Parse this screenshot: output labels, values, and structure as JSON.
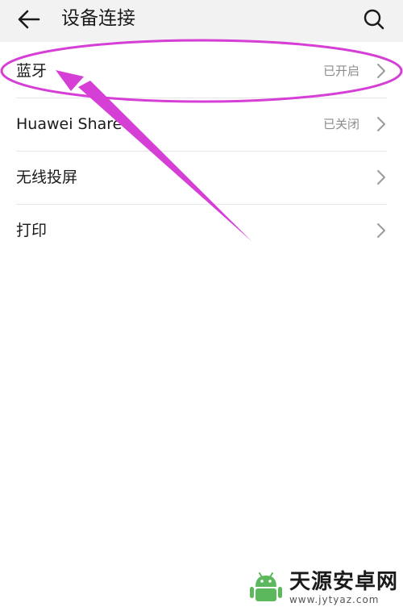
{
  "header": {
    "title": "设备连接",
    "back_icon": "arrow-left-icon",
    "search_icon": "search-icon"
  },
  "rows": [
    {
      "label": "蓝牙",
      "status": "已开启"
    },
    {
      "label": "Huawei Share",
      "status": "已关闭"
    },
    {
      "label": "无线投屏",
      "status": ""
    },
    {
      "label": "打印",
      "status": ""
    }
  ],
  "annotation": {
    "color": "#d63fd6"
  },
  "watermark": {
    "title": "天源安卓网",
    "url": "www.jytyaz.com",
    "logo_color": "#5cb85c"
  }
}
